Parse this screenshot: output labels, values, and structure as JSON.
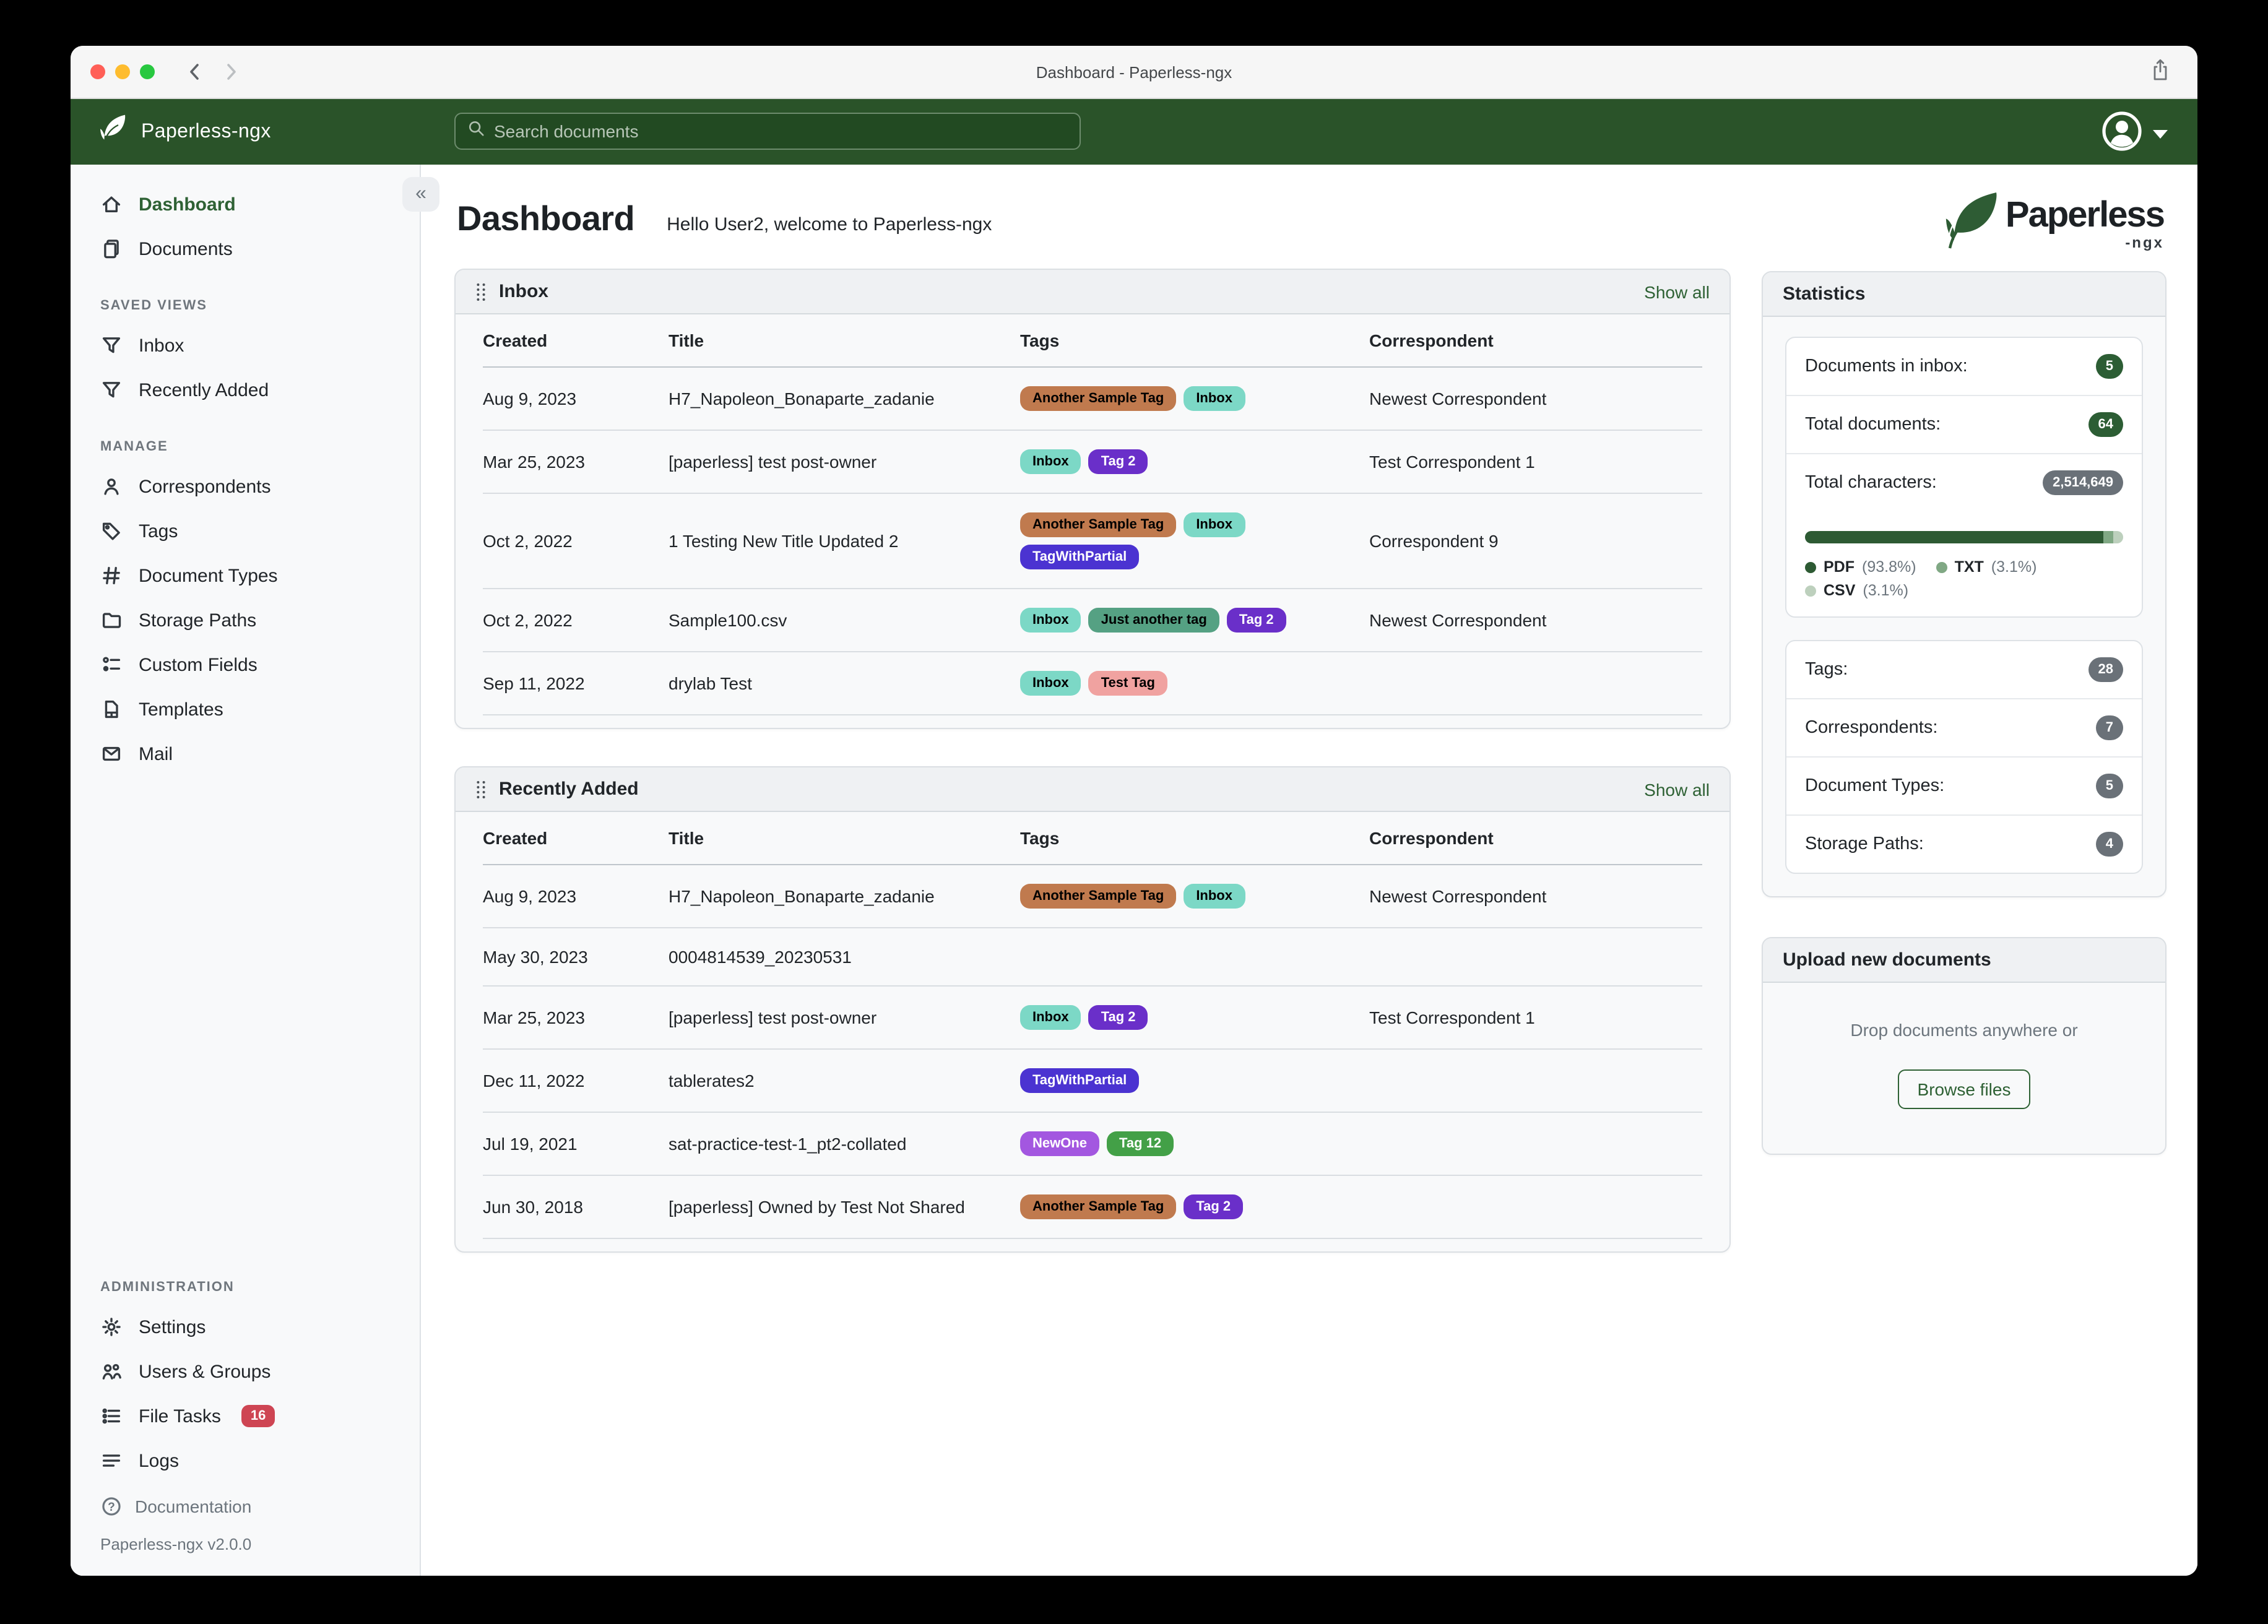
{
  "window": {
    "title": "Dashboard - Paperless-ngx"
  },
  "navbar": {
    "brand": "Paperless-ngx",
    "search_placeholder": "Search documents"
  },
  "sidebar": {
    "items_top": [
      {
        "label": "Dashboard",
        "icon": "home",
        "active": true
      },
      {
        "label": "Documents",
        "icon": "documents",
        "active": false
      }
    ],
    "sections": [
      {
        "title": "SAVED VIEWS",
        "push": false,
        "items": [
          {
            "label": "Inbox",
            "icon": "filter"
          },
          {
            "label": "Recently Added",
            "icon": "filter"
          }
        ]
      },
      {
        "title": "MANAGE",
        "push": false,
        "items": [
          {
            "label": "Correspondents",
            "icon": "person"
          },
          {
            "label": "Tags",
            "icon": "tag"
          },
          {
            "label": "Document Types",
            "icon": "hash"
          },
          {
            "label": "Storage Paths",
            "icon": "folder"
          },
          {
            "label": "Custom Fields",
            "icon": "fields"
          },
          {
            "label": "Templates",
            "icon": "file"
          },
          {
            "label": "Mail",
            "icon": "mail"
          }
        ]
      },
      {
        "title": "ADMINISTRATION",
        "push": true,
        "items": [
          {
            "label": "Settings",
            "icon": "gear"
          },
          {
            "label": "Users & Groups",
            "icon": "users"
          },
          {
            "label": "File Tasks",
            "icon": "tasks",
            "badge": "16"
          },
          {
            "label": "Logs",
            "icon": "logs"
          }
        ]
      }
    ],
    "footer": {
      "documentation": "Documentation",
      "version": "Paperless-ngx v2.0.0"
    }
  },
  "header": {
    "title": "Dashboard",
    "greeting": "Hello User2, welcome to Paperless-ngx"
  },
  "logo": {
    "word": "Paperless",
    "sub": "-ngx"
  },
  "tag_colors": {
    "Another Sample Tag": {
      "bg": "#c07a4e",
      "fg": "#000000"
    },
    "Inbox": {
      "bg": "#7cd8c6",
      "fg": "#000000"
    },
    "Tag 2": {
      "bg": "#6a2fc9",
      "fg": "#ffffff"
    },
    "TagWithPartial": {
      "bg": "#4b33d1",
      "fg": "#ffffff"
    },
    "Just another tag": {
      "bg": "#55a183",
      "fg": "#000000"
    },
    "Test Tag": {
      "bg": "#f0a2a0",
      "fg": "#000000"
    },
    "NewOne": {
      "bg": "#a357e0",
      "fg": "#ffffff"
    },
    "Tag 12": {
      "bg": "#43a047",
      "fg": "#ffffff"
    }
  },
  "widgets": {
    "inbox": {
      "title": "Inbox",
      "show_all": "Show all",
      "columns": [
        "Created",
        "Title",
        "Tags",
        "Correspondent"
      ],
      "rows": [
        {
          "created": "Aug 9, 2023",
          "title": "H7_Napoleon_Bonaparte_zadanie",
          "tags": [
            "Another Sample Tag",
            "Inbox"
          ],
          "correspondent": "Newest Correspondent"
        },
        {
          "created": "Mar 25, 2023",
          "title": "[paperless] test post-owner",
          "tags": [
            "Inbox",
            "Tag 2"
          ],
          "correspondent": "Test Correspondent 1"
        },
        {
          "created": "Oct 2, 2022",
          "title": "1 Testing New Title Updated 2",
          "tags": [
            "Another Sample Tag",
            "Inbox",
            "TagWithPartial"
          ],
          "correspondent": "Correspondent 9"
        },
        {
          "created": "Oct 2, 2022",
          "title": "Sample100.csv",
          "tags": [
            "Inbox",
            "Just another tag",
            "Tag 2"
          ],
          "correspondent": "Newest Correspondent"
        },
        {
          "created": "Sep 11, 2022",
          "title": "drylab Test",
          "tags": [
            "Inbox",
            "Test Tag"
          ],
          "correspondent": ""
        }
      ]
    },
    "recent": {
      "title": "Recently Added",
      "show_all": "Show all",
      "columns": [
        "Created",
        "Title",
        "Tags",
        "Correspondent"
      ],
      "rows": [
        {
          "created": "Aug 9, 2023",
          "title": "H7_Napoleon_Bonaparte_zadanie",
          "tags": [
            "Another Sample Tag",
            "Inbox"
          ],
          "correspondent": "Newest Correspondent"
        },
        {
          "created": "May 30, 2023",
          "title": "0004814539_20230531",
          "tags": [],
          "correspondent": ""
        },
        {
          "created": "Mar 25, 2023",
          "title": "[paperless] test post-owner",
          "tags": [
            "Inbox",
            "Tag 2"
          ],
          "correspondent": "Test Correspondent 1"
        },
        {
          "created": "Dec 11, 2022",
          "title": "tablerates2",
          "tags": [
            "TagWithPartial"
          ],
          "correspondent": ""
        },
        {
          "created": "Jul 19, 2021",
          "title": "sat-practice-test-1_pt2-collated",
          "tags": [
            "NewOne",
            "Tag 12"
          ],
          "correspondent": ""
        },
        {
          "created": "Jun 30, 2018",
          "title": "[paperless] Owned by Test Not Shared",
          "tags": [
            "Another Sample Tag",
            "Tag 2"
          ],
          "correspondent": ""
        }
      ]
    },
    "statistics": {
      "title": "Statistics",
      "rows": [
        {
          "label": "Documents in inbox:",
          "badge": "5",
          "style": "green"
        },
        {
          "label": "Total documents:",
          "badge": "64",
          "style": "green"
        },
        {
          "label": "Total characters:",
          "badge": "2,514,649",
          "style": "gray"
        }
      ],
      "file_types": [
        {
          "name": "PDF",
          "pct_label": "(93.8%)",
          "value": 93.8,
          "color": "#2d5a33"
        },
        {
          "name": "TXT",
          "pct_label": "(3.1%)",
          "value": 3.1,
          "color": "#80a884"
        },
        {
          "name": "CSV",
          "pct_label": "(3.1%)",
          "value": 3.1,
          "color": "#bdd0bd"
        }
      ],
      "counts": [
        {
          "label": "Tags:",
          "badge": "28",
          "style": "gray"
        },
        {
          "label": "Correspondents:",
          "badge": "7",
          "style": "gray"
        },
        {
          "label": "Document Types:",
          "badge": "5",
          "style": "gray"
        },
        {
          "label": "Storage Paths:",
          "badge": "4",
          "style": "gray"
        }
      ]
    },
    "upload": {
      "title": "Upload new documents",
      "hint": "Drop documents anywhere or",
      "button": "Browse files"
    }
  }
}
